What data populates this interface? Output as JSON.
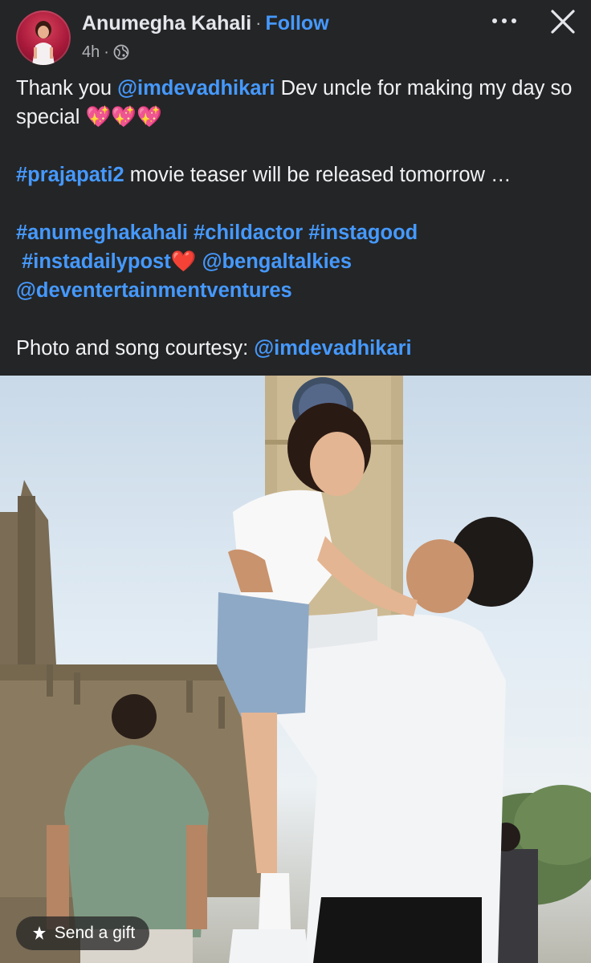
{
  "post": {
    "author": "Anumegha Kahali",
    "separator": "·",
    "follow_label": "Follow",
    "time": "4h",
    "meta_separator": "·",
    "privacy_icon": "globe-icon"
  },
  "actions": {
    "more_icon": "more-horizontal-icon",
    "close_icon": "close-icon"
  },
  "caption": {
    "line1_prefix": "Thank you ",
    "line1_mention": "@imdevadhikari",
    "line1_suffix": " Dev uncle for making my day so special 💖💖💖",
    "line2_tag": "#prajapati2",
    "line2_text": " movie teaser will be released tomorrow …",
    "tag_a": "#anumeghakahali",
    "tag_b": "#childactor",
    "tag_c": "#instagood",
    "tag_d": "#instadailypost",
    "heart": "❤️",
    "mention_a": "@bengaltalkies",
    "mention_b": "@deventertainmentventures",
    "credit_text": "Photo and song courtesy: ",
    "credit_mention": "@imdevadhikari"
  },
  "photo": {
    "subject": "post-photo"
  },
  "gift": {
    "label": "Send a gift",
    "icon": "gift-icon"
  }
}
